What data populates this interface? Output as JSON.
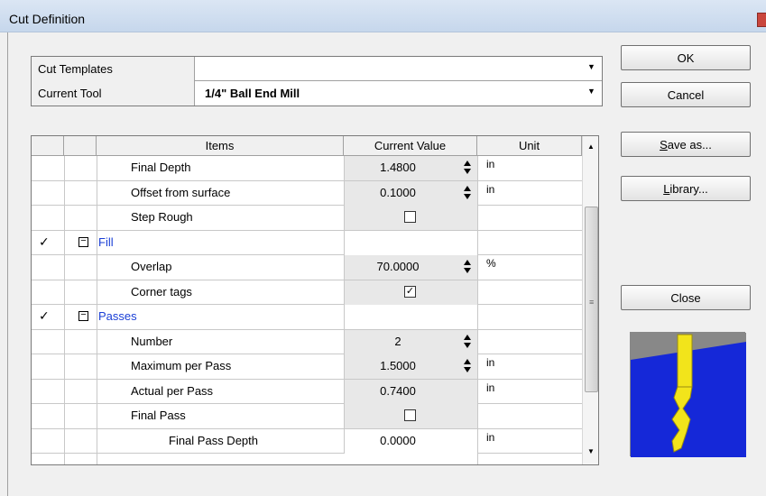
{
  "window": {
    "title": "Cut Definition"
  },
  "combos": [
    {
      "label": "Cut Templates",
      "value": ""
    },
    {
      "label": "Current Tool",
      "value": "1/4\" Ball End Mill"
    }
  ],
  "buttons": {
    "ok": "OK",
    "cancel": "Cancel",
    "save_as_mnemonic": "S",
    "save_as_rest": "ave as...",
    "library_mnemonic": "L",
    "library_rest": "ibrary...",
    "close": "Close"
  },
  "grid": {
    "headers": {
      "items": "Items",
      "current_value": "Current Value",
      "unit": "Unit"
    },
    "rows": [
      {
        "item": "Final Depth",
        "value": "1.4800",
        "unit": "in"
      },
      {
        "item": "Offset from surface",
        "value": "0.1000",
        "unit": "in"
      },
      {
        "item": "Step Rough",
        "checked": false
      },
      {
        "section": "Fill"
      },
      {
        "item": "Overlap",
        "value": "70.0000",
        "unit": "%"
      },
      {
        "item": "Corner tags",
        "checked": true
      },
      {
        "section": "Passes"
      },
      {
        "item": "Number",
        "value": "2",
        "unit": ""
      },
      {
        "item": "Maximum per Pass",
        "value": "1.5000",
        "unit": "in"
      },
      {
        "item": "Actual per Pass",
        "value": "0.7400",
        "unit": "in"
      },
      {
        "item": "Final Pass",
        "checked": false
      },
      {
        "item": "Final Pass Depth",
        "value": "0.0000",
        "unit": "in"
      }
    ]
  },
  "icons": {
    "check": "checkmark-icon",
    "collapse": "minus-box-icon"
  }
}
